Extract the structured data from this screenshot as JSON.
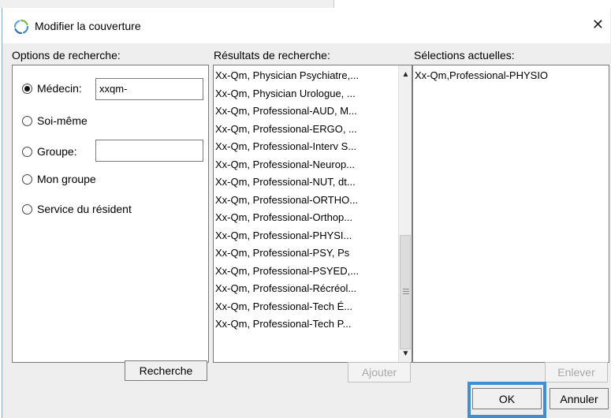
{
  "window": {
    "title": "Modifier la couverture",
    "close_glyph": "✕"
  },
  "search_options": {
    "label": "Options de recherche:",
    "medecin": {
      "label": "Médecin:",
      "value": "xxqm-",
      "selected": true
    },
    "soi_meme": {
      "label": "Soi-même"
    },
    "groupe": {
      "label": "Groupe:",
      "value": ""
    },
    "mon_groupe": {
      "label": "Mon groupe"
    },
    "service": {
      "label": "Service du résident"
    },
    "search_button": "Recherche"
  },
  "results": {
    "label": "Résultats de recherche:",
    "items": [
      "Xx-Qm, Physician Psychiatre,...",
      "Xx-Qm, Physician Urologue, ...",
      "Xx-Qm, Professional-AUD, M...",
      "Xx-Qm, Professional-ERGO, ...",
      "Xx-Qm, Professional-Interv S...",
      "Xx-Qm, Professional-Neurop...",
      "Xx-Qm, Professional-NUT, dt...",
      "Xx-Qm, Professional-ORTHO...",
      "Xx-Qm, Professional-Orthop...",
      "Xx-Qm, Professional-PHYSI...",
      "Xx-Qm, Professional-PSY, Ps",
      "Xx-Qm, Professional-PSYED,...",
      "Xx-Qm, Professional-Récréol...",
      "Xx-Qm, Professional-Tech É...",
      "Xx-Qm, Professional-Tech P..."
    ],
    "add_button": "Ajouter"
  },
  "current": {
    "label": "Sélections actuelles:",
    "items": [
      "Xx-Qm,Professional-PHYSIO"
    ],
    "remove_button": "Enlever"
  },
  "footer": {
    "ok": "OK",
    "cancel": "Annuler"
  },
  "colors": {
    "highlight": "#3f8fd2",
    "dialog_bg": "#eeeeee"
  }
}
